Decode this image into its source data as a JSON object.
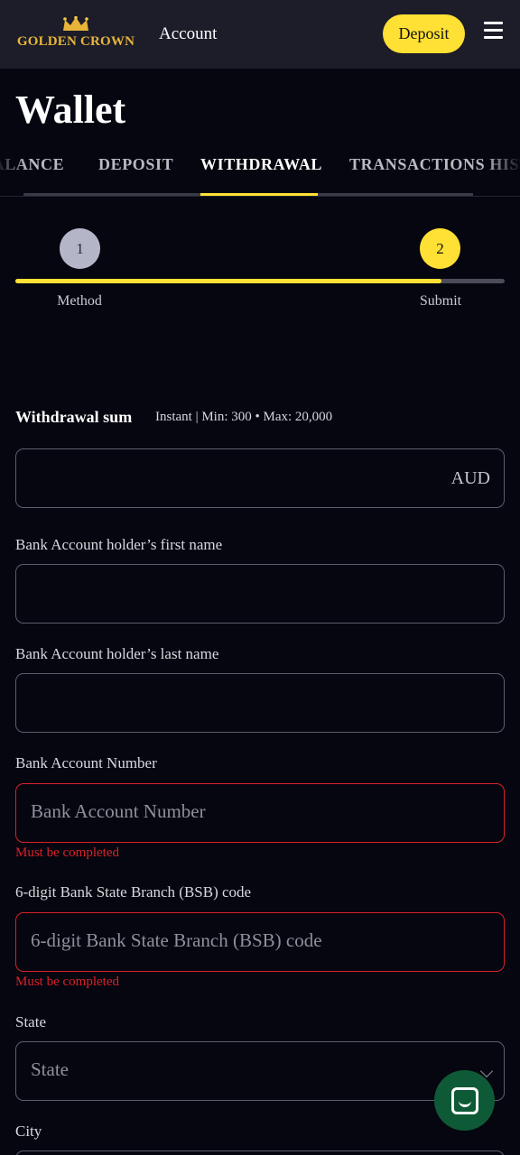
{
  "header": {
    "logo_text": "GOLDEN CROWN",
    "account_label": "Account",
    "deposit_label": "Deposit",
    "menu_icon": "hamburger-menu-icon",
    "brand_color": "#ffe034",
    "logo_color": "#e8b53a"
  },
  "page": {
    "title": "Wallet"
  },
  "tabs": [
    {
      "label": "BALANCE",
      "active": false
    },
    {
      "label": "DEPOSIT",
      "active": false
    },
    {
      "label": "WITHDRAWAL",
      "active": true
    },
    {
      "label": "TRANSACTIONS HISTORY",
      "active": false
    }
  ],
  "stepper": {
    "steps": [
      {
        "number": "1",
        "label": "Method"
      },
      {
        "number": "2",
        "label": "Submit"
      }
    ],
    "current_step": 2,
    "progress_percent": 87
  },
  "form": {
    "sum_label": "Withdrawal sum",
    "sum_info": "Instant | Min: 300 • Max: 20,000",
    "currency": "AUD",
    "fields": {
      "first_name": {
        "label": "Bank Account holder’s first name",
        "value": ""
      },
      "last_name": {
        "label": "Bank Account holder’s last name",
        "value": ""
      },
      "account_number": {
        "label": "Bank Account Number",
        "placeholder": "Bank Account Number",
        "error": "Must be completed"
      },
      "bsb": {
        "label": "6-digit Bank State Branch (BSB) code",
        "placeholder": "6-digit Bank State Branch (BSB) code",
        "error": "Must be completed"
      },
      "state": {
        "label": "State",
        "placeholder": "State"
      },
      "city": {
        "label": "City"
      }
    },
    "error_color": "#d8222a"
  },
  "chat": {
    "icon": "chat-support-icon",
    "color": "#0f5a36"
  }
}
